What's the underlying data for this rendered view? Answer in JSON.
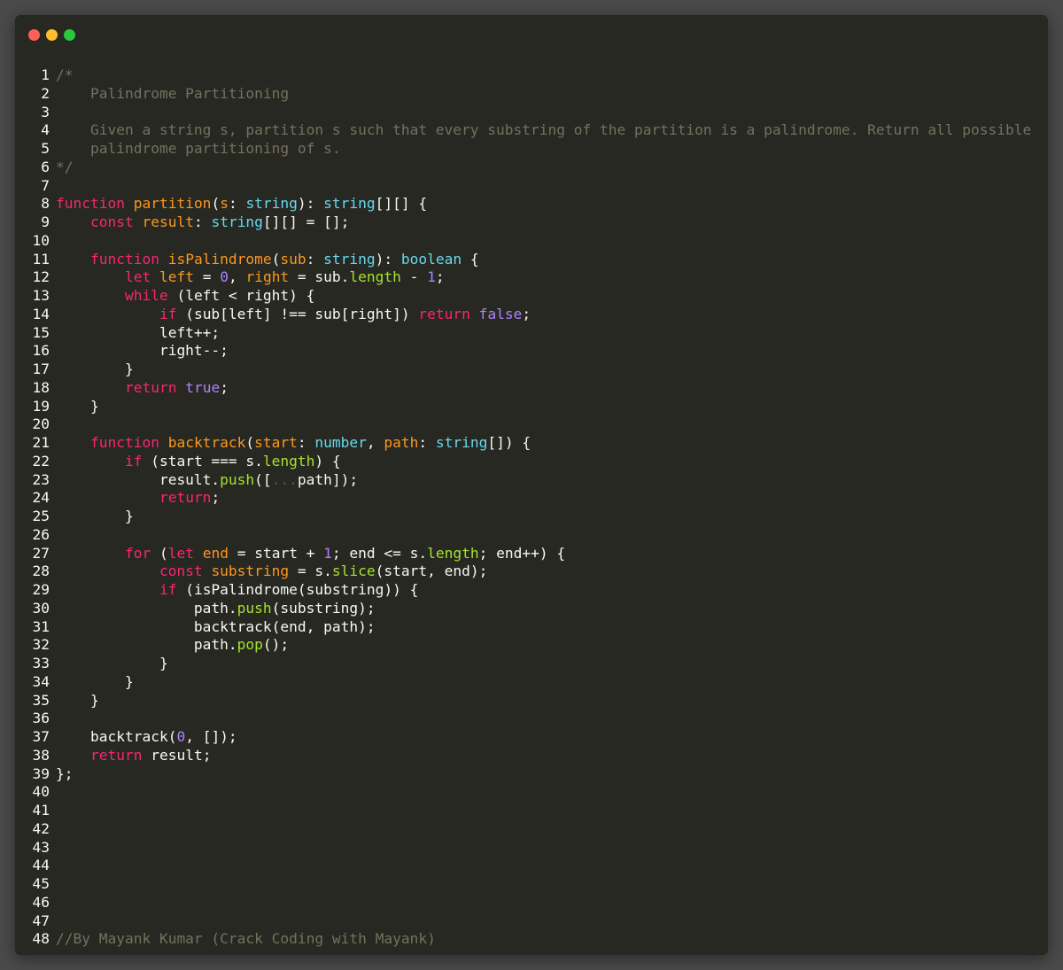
{
  "colors": {
    "background": "#272822",
    "page": "#4a4a4a",
    "default": "#f8f8f2",
    "comment": "#75715e",
    "keyword": "#f92672",
    "function": "#fd971f",
    "param": "#fd971f",
    "type": "#66d9ef",
    "property": "#a6e22e",
    "number": "#ae81ff",
    "spread": "#5a5a50"
  },
  "window_controls": [
    {
      "name": "close",
      "color": "#ff5f56"
    },
    {
      "name": "minimize",
      "color": "#ffbd2e"
    },
    {
      "name": "maximize",
      "color": "#27c93f"
    }
  ],
  "lines": [
    {
      "n": "1",
      "tokens": [
        [
          "/*",
          "comment"
        ]
      ]
    },
    {
      "n": "2",
      "tokens": [
        [
          "    Palindrome Partitioning",
          "comment"
        ]
      ]
    },
    {
      "n": "3",
      "tokens": []
    },
    {
      "n": "4",
      "tokens": [
        [
          "    Given a string s, partition s such that every substring of the partition is a palindrome. Return all possible",
          "comment"
        ]
      ]
    },
    {
      "n": "5",
      "tokens": [
        [
          "    palindrome partitioning of s.",
          "comment"
        ]
      ]
    },
    {
      "n": "6",
      "tokens": [
        [
          "*/",
          "comment"
        ]
      ]
    },
    {
      "n": "7",
      "tokens": []
    },
    {
      "n": "8",
      "tokens": [
        [
          "function",
          "keyword"
        ],
        [
          " ",
          "default"
        ],
        [
          "partition",
          "function"
        ],
        [
          "(",
          "default"
        ],
        [
          "s",
          "param"
        ],
        [
          ": ",
          "default"
        ],
        [
          "string",
          "type"
        ],
        [
          "): ",
          "default"
        ],
        [
          "string",
          "type"
        ],
        [
          "[][] {",
          "default"
        ]
      ]
    },
    {
      "n": "9",
      "tokens": [
        [
          "    ",
          "default"
        ],
        [
          "const",
          "keyword"
        ],
        [
          " ",
          "default"
        ],
        [
          "result",
          "param"
        ],
        [
          ": ",
          "default"
        ],
        [
          "string",
          "type"
        ],
        [
          "[][] = [];",
          "default"
        ]
      ]
    },
    {
      "n": "10",
      "tokens": []
    },
    {
      "n": "11",
      "tokens": [
        [
          "    ",
          "default"
        ],
        [
          "function",
          "keyword"
        ],
        [
          " ",
          "default"
        ],
        [
          "isPalindrome",
          "function"
        ],
        [
          "(",
          "default"
        ],
        [
          "sub",
          "param"
        ],
        [
          ": ",
          "default"
        ],
        [
          "string",
          "type"
        ],
        [
          "): ",
          "default"
        ],
        [
          "boolean",
          "type"
        ],
        [
          " {",
          "default"
        ]
      ]
    },
    {
      "n": "12",
      "tokens": [
        [
          "        ",
          "default"
        ],
        [
          "let",
          "keyword"
        ],
        [
          " ",
          "default"
        ],
        [
          "left",
          "param"
        ],
        [
          " = ",
          "default"
        ],
        [
          "0",
          "number"
        ],
        [
          ", ",
          "default"
        ],
        [
          "right",
          "param"
        ],
        [
          " = sub.",
          "default"
        ],
        [
          "length",
          "property"
        ],
        [
          " - ",
          "default"
        ],
        [
          "1",
          "number"
        ],
        [
          ";",
          "default"
        ]
      ]
    },
    {
      "n": "13",
      "tokens": [
        [
          "        ",
          "default"
        ],
        [
          "while",
          "keyword"
        ],
        [
          " (left < right) {",
          "default"
        ]
      ]
    },
    {
      "n": "14",
      "tokens": [
        [
          "            ",
          "default"
        ],
        [
          "if",
          "keyword"
        ],
        [
          " (sub[left] !== sub[right]) ",
          "default"
        ],
        [
          "return",
          "keyword"
        ],
        [
          " ",
          "default"
        ],
        [
          "false",
          "number"
        ],
        [
          ";",
          "default"
        ]
      ]
    },
    {
      "n": "15",
      "tokens": [
        [
          "            left++;",
          "default"
        ]
      ]
    },
    {
      "n": "16",
      "tokens": [
        [
          "            right--;",
          "default"
        ]
      ]
    },
    {
      "n": "17",
      "tokens": [
        [
          "        }",
          "default"
        ]
      ]
    },
    {
      "n": "18",
      "tokens": [
        [
          "        ",
          "default"
        ],
        [
          "return",
          "keyword"
        ],
        [
          " ",
          "default"
        ],
        [
          "true",
          "number"
        ],
        [
          ";",
          "default"
        ]
      ]
    },
    {
      "n": "19",
      "tokens": [
        [
          "    }",
          "default"
        ]
      ]
    },
    {
      "n": "20",
      "tokens": []
    },
    {
      "n": "21",
      "tokens": [
        [
          "    ",
          "default"
        ],
        [
          "function",
          "keyword"
        ],
        [
          " ",
          "default"
        ],
        [
          "backtrack",
          "function"
        ],
        [
          "(",
          "default"
        ],
        [
          "start",
          "param"
        ],
        [
          ": ",
          "default"
        ],
        [
          "number",
          "type"
        ],
        [
          ", ",
          "default"
        ],
        [
          "path",
          "param"
        ],
        [
          ": ",
          "default"
        ],
        [
          "string",
          "type"
        ],
        [
          "[]) {",
          "default"
        ]
      ]
    },
    {
      "n": "22",
      "tokens": [
        [
          "        ",
          "default"
        ],
        [
          "if",
          "keyword"
        ],
        [
          " (start === s.",
          "default"
        ],
        [
          "length",
          "property"
        ],
        [
          ") {",
          "default"
        ]
      ]
    },
    {
      "n": "23",
      "tokens": [
        [
          "            result.",
          "default"
        ],
        [
          "push",
          "property"
        ],
        [
          "([",
          "default"
        ],
        [
          "...",
          "spread"
        ],
        [
          "path]);",
          "default"
        ]
      ]
    },
    {
      "n": "24",
      "tokens": [
        [
          "            ",
          "default"
        ],
        [
          "return",
          "keyword"
        ],
        [
          ";",
          "default"
        ]
      ]
    },
    {
      "n": "25",
      "tokens": [
        [
          "        }",
          "default"
        ]
      ]
    },
    {
      "n": "26",
      "tokens": []
    },
    {
      "n": "27",
      "tokens": [
        [
          "        ",
          "default"
        ],
        [
          "for",
          "keyword"
        ],
        [
          " (",
          "default"
        ],
        [
          "let",
          "keyword"
        ],
        [
          " ",
          "default"
        ],
        [
          "end",
          "param"
        ],
        [
          " = start + ",
          "default"
        ],
        [
          "1",
          "number"
        ],
        [
          "; end <= s.",
          "default"
        ],
        [
          "length",
          "property"
        ],
        [
          "; end++) {",
          "default"
        ]
      ]
    },
    {
      "n": "28",
      "tokens": [
        [
          "            ",
          "default"
        ],
        [
          "const",
          "keyword"
        ],
        [
          " ",
          "default"
        ],
        [
          "substring",
          "param"
        ],
        [
          " = s.",
          "default"
        ],
        [
          "slice",
          "property"
        ],
        [
          "(start, end);",
          "default"
        ]
      ]
    },
    {
      "n": "29",
      "tokens": [
        [
          "            ",
          "default"
        ],
        [
          "if",
          "keyword"
        ],
        [
          " (isPalindrome(substring)) {",
          "default"
        ]
      ]
    },
    {
      "n": "30",
      "tokens": [
        [
          "                path.",
          "default"
        ],
        [
          "push",
          "property"
        ],
        [
          "(substring);",
          "default"
        ]
      ]
    },
    {
      "n": "31",
      "tokens": [
        [
          "                backtrack(end, path);",
          "default"
        ]
      ]
    },
    {
      "n": "32",
      "tokens": [
        [
          "                path.",
          "default"
        ],
        [
          "pop",
          "property"
        ],
        [
          "();",
          "default"
        ]
      ]
    },
    {
      "n": "33",
      "tokens": [
        [
          "            }",
          "default"
        ]
      ]
    },
    {
      "n": "34",
      "tokens": [
        [
          "        }",
          "default"
        ]
      ]
    },
    {
      "n": "35",
      "tokens": [
        [
          "    }",
          "default"
        ]
      ]
    },
    {
      "n": "36",
      "tokens": []
    },
    {
      "n": "37",
      "tokens": [
        [
          "    backtrack(",
          "default"
        ],
        [
          "0",
          "number"
        ],
        [
          ", []);",
          "default"
        ]
      ]
    },
    {
      "n": "38",
      "tokens": [
        [
          "    ",
          "default"
        ],
        [
          "return",
          "keyword"
        ],
        [
          " result;",
          "default"
        ]
      ]
    },
    {
      "n": "39",
      "tokens": [
        [
          "};",
          "default"
        ]
      ]
    },
    {
      "n": "40",
      "tokens": []
    },
    {
      "n": "41",
      "tokens": []
    },
    {
      "n": "42",
      "tokens": []
    },
    {
      "n": "43",
      "tokens": []
    },
    {
      "n": "44",
      "tokens": []
    },
    {
      "n": "45",
      "tokens": []
    },
    {
      "n": "46",
      "tokens": []
    },
    {
      "n": "47",
      "tokens": []
    },
    {
      "n": "48",
      "tokens": [
        [
          "//By Mayank Kumar (Crack Coding with Mayank)",
          "comment"
        ]
      ]
    }
  ]
}
